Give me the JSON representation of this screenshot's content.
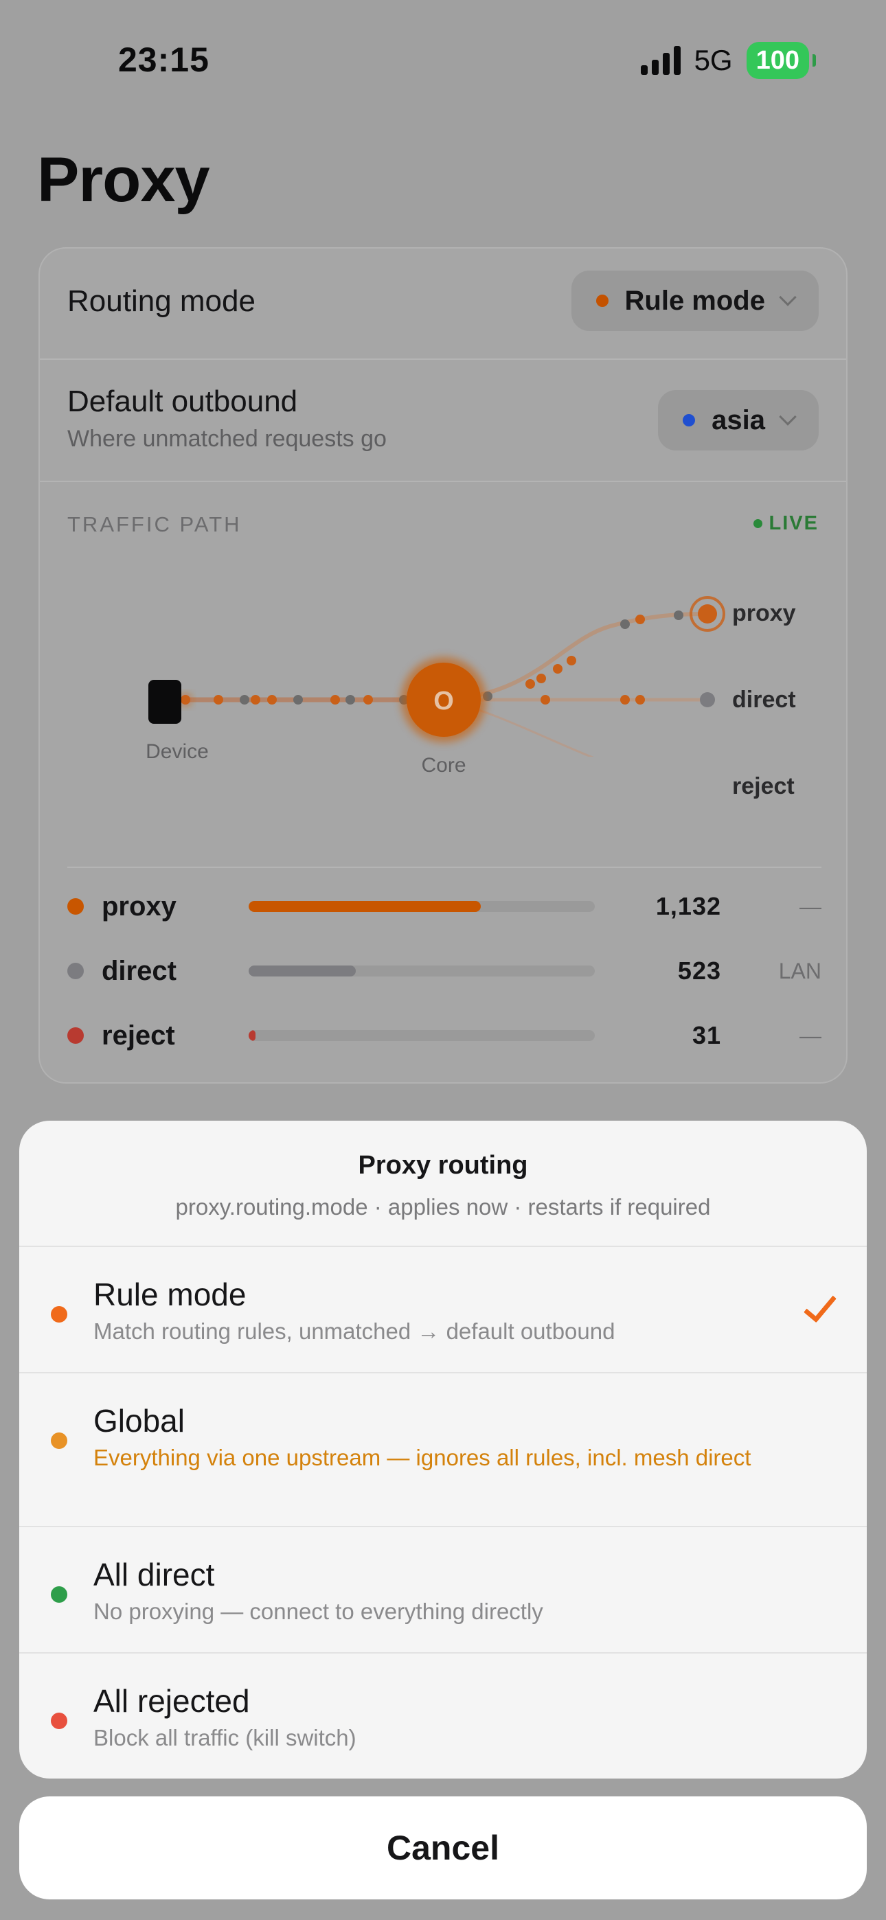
{
  "status_bar": {
    "time": "23:15",
    "network": "5G",
    "battery": "100"
  },
  "page_title": "Proxy",
  "routing": {
    "label": "Routing mode",
    "value": "Rule mode",
    "dot_color": "#c45200"
  },
  "outbound": {
    "label": "Default outbound",
    "sublabel": "Where unmatched requests go",
    "value": "asia",
    "dot_color": "#1f4fd0"
  },
  "traffic": {
    "section_label": "TRAFFIC PATH",
    "live_label": "LIVE",
    "device_label": "Device",
    "core_label": "Core",
    "core_glyph": "O",
    "outputs": {
      "proxy": "proxy",
      "direct": "direct",
      "reject": "reject"
    },
    "stats": [
      {
        "name": "proxy",
        "count": "1,132",
        "note": "—",
        "color": "#c85600",
        "fraction": 0.67
      },
      {
        "name": "direct",
        "count": "523",
        "note": "LAN",
        "color": "#7c7c80",
        "fraction": 0.31
      },
      {
        "name": "reject",
        "count": "31",
        "note": "—",
        "color": "#b83a30",
        "fraction": 0.02
      }
    ]
  },
  "sheet": {
    "title": "Proxy routing",
    "subtitle": "proxy.routing.mode · applies now · restarts if required",
    "options": [
      {
        "name": "Rule mode",
        "desc": "Match routing rules, unmatched → default outbound",
        "color": "#f06a1a",
        "selected": true
      },
      {
        "name": "Global",
        "desc": "Everything via one upstream — ignores all rules, incl. mesh direct",
        "color": "#e89226",
        "warning": true
      },
      {
        "name": "All direct",
        "desc": "No proxying — connect to everything directly",
        "color": "#2e9e4a"
      },
      {
        "name": "All rejected",
        "desc": "Block all traffic (kill switch)",
        "color": "#e8503e"
      }
    ],
    "cancel": "Cancel"
  }
}
